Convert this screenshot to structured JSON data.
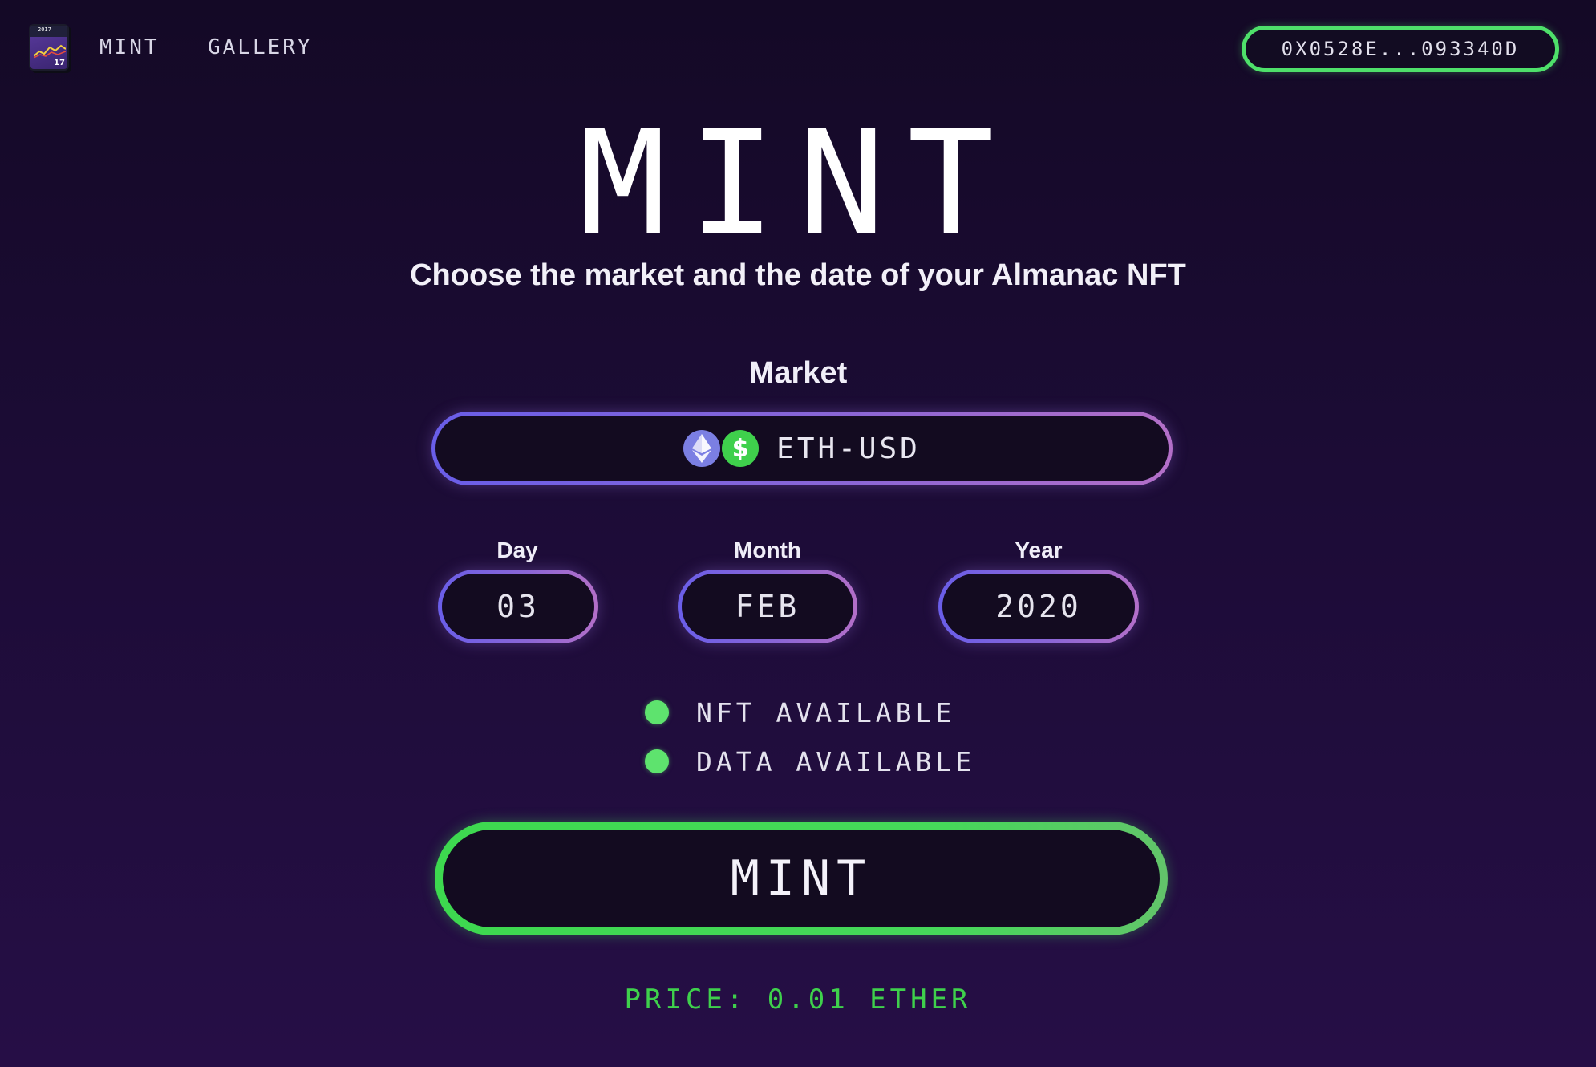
{
  "header": {
    "logo": {
      "year": "2017",
      "day": "17"
    },
    "nav": [
      {
        "label": "MINT"
      },
      {
        "label": "GALLERY"
      }
    ],
    "wallet_address": "0X0528E...093340D"
  },
  "hero": {
    "title": "MINT",
    "subtitle": "Choose the market and the date of your Almanac NFT"
  },
  "market": {
    "label": "Market",
    "selected": "ETH-USD",
    "icons": [
      "ethereum-icon",
      "dollar-icon"
    ],
    "usd_symbol": "$"
  },
  "date": {
    "day_label": "Day",
    "day_value": "03",
    "month_label": "Month",
    "month_value": "FEB",
    "year_label": "Year",
    "year_value": "2020"
  },
  "availability": [
    {
      "label": "NFT AVAILABLE",
      "color": "#5ee36e"
    },
    {
      "label": "DATA AVAILABLE",
      "color": "#5ee36e"
    }
  ],
  "mint_button": {
    "label": "MINT"
  },
  "price": "PRICE: 0.01 ETHER",
  "colors": {
    "background": "#1c0c36",
    "accent_green": "#3fd04c",
    "accent_purple": "#8a66d6"
  }
}
